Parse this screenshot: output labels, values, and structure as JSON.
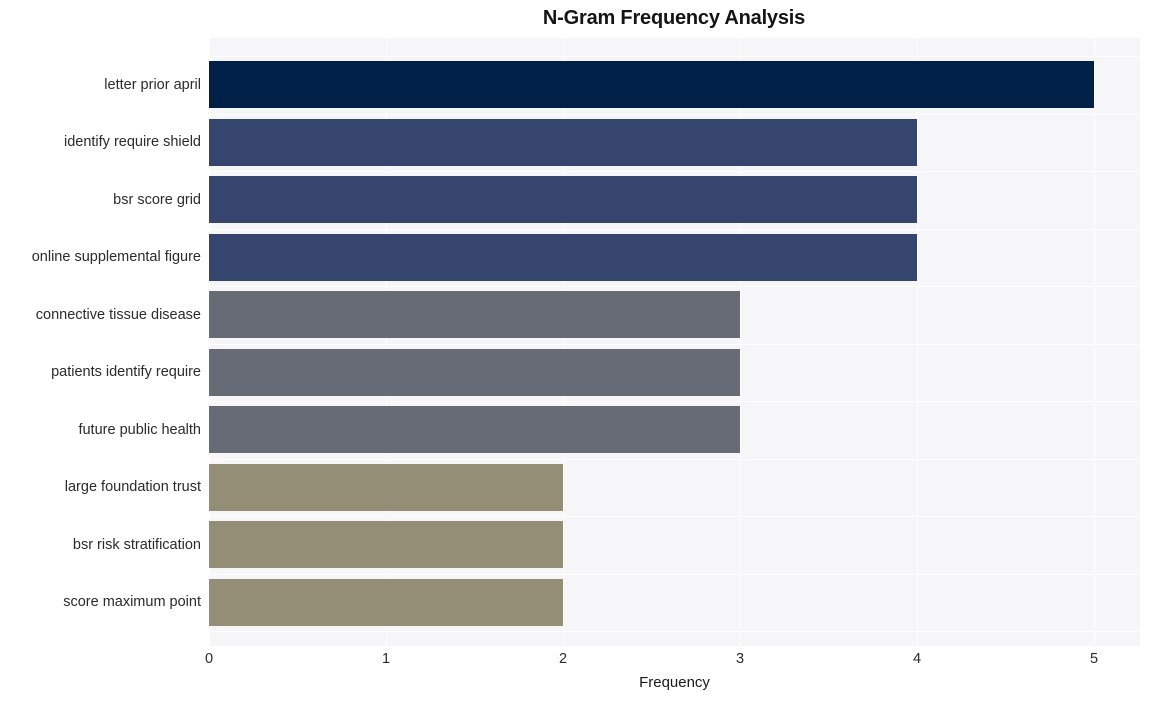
{
  "chart_data": {
    "type": "bar",
    "orientation": "horizontal",
    "title": "N-Gram Frequency Analysis",
    "xlabel": "Frequency",
    "ylabel": "",
    "xlim": [
      0,
      5
    ],
    "grid": true,
    "legend": "none",
    "xticks": [
      "0",
      "1",
      "2",
      "3",
      "4",
      "5"
    ],
    "xtick_values": [
      0,
      1,
      2,
      3,
      4,
      5
    ],
    "categories": [
      "letter prior april",
      "identify require shield",
      "bsr score grid",
      "online supplemental figure",
      "connective tissue disease",
      "patients identify require",
      "future public health",
      "large foundation trust",
      "bsr risk stratification",
      "score maximum point"
    ],
    "values": [
      5,
      4,
      4,
      4,
      3,
      3,
      3,
      2,
      2,
      2
    ],
    "bar_colors": [
      "#002147",
      "#36456e",
      "#36456e",
      "#36456e",
      "#666b75",
      "#666b75",
      "#666b75",
      "#948e77",
      "#948e77",
      "#948e77"
    ],
    "plot_background": "#f6f6f8",
    "gridline_color": "#ffffff",
    "figure_background": "#ffffff"
  }
}
